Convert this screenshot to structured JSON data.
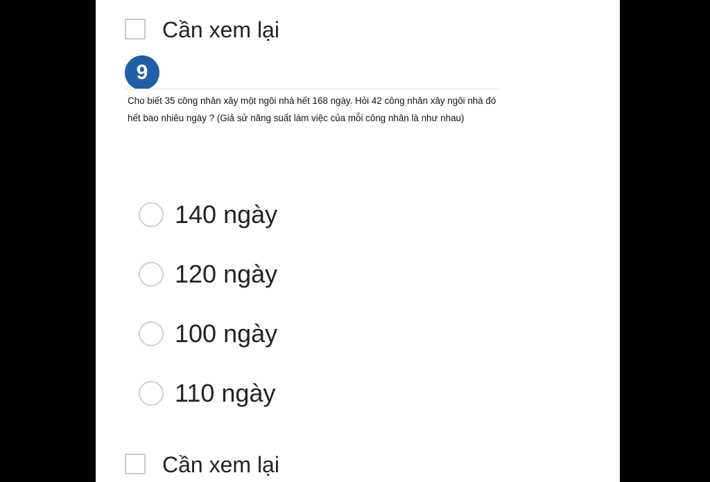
{
  "review": {
    "label": "Cần xem lại"
  },
  "question": {
    "number": "9",
    "text": "Cho biết 35 công nhân xây một ngôi nhà hết 168 ngày. Hỏi 42 công nhân xây ngôi nhà đó hết bao nhiêu ngày ? (Giả sử năng suất làm việc của mỗi công nhân là như nhau)"
  },
  "options": [
    {
      "label": "140 ngày"
    },
    {
      "label": "120 ngày"
    },
    {
      "label": "100 ngày"
    },
    {
      "label": "110 ngày"
    }
  ],
  "colors": {
    "badge": "#1e5fa8",
    "background": "#000000",
    "card": "#ffffff"
  },
  "icons": {
    "checkbox": "checkbox-icon",
    "radio": "radio-icon"
  }
}
